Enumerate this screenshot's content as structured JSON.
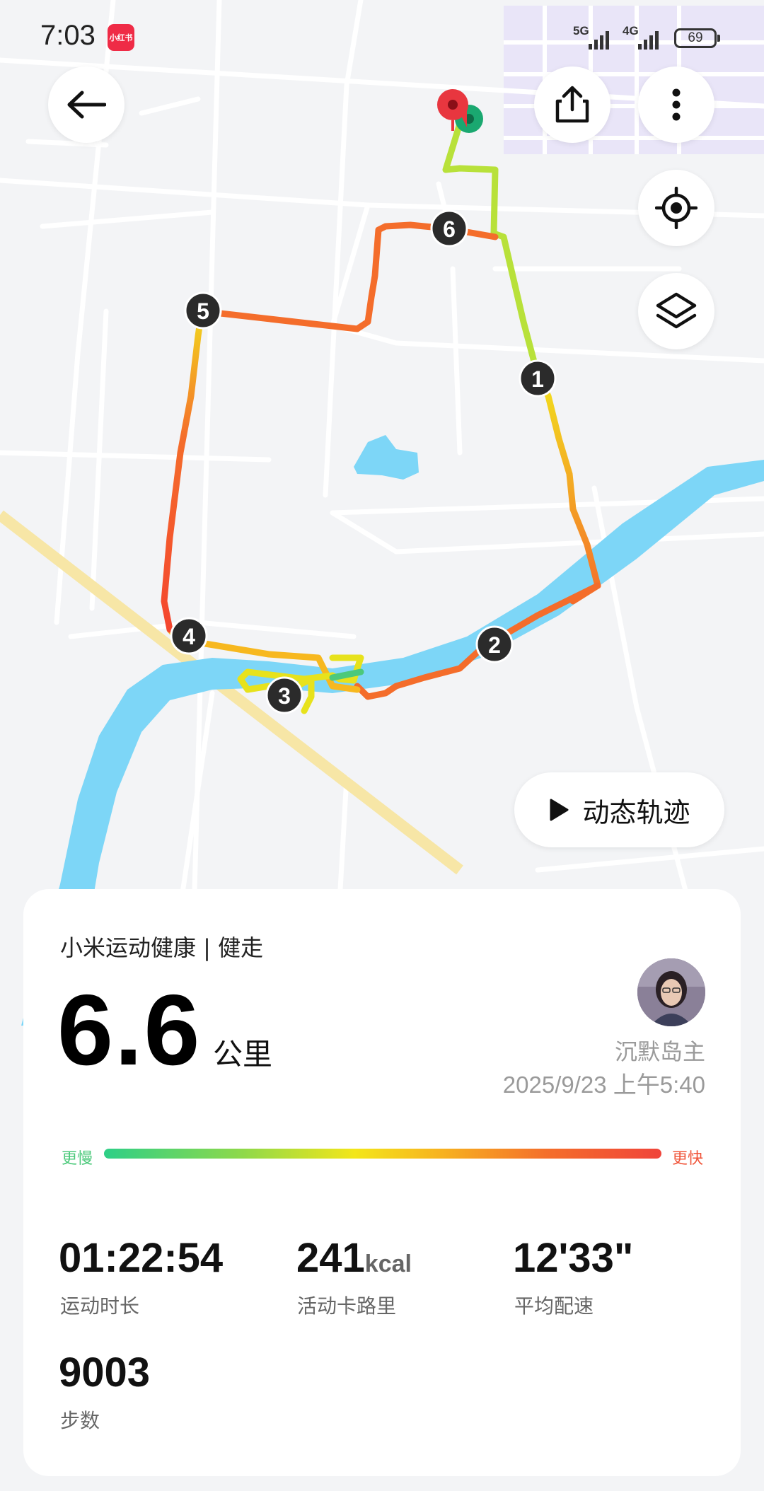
{
  "status_bar": {
    "time": "7:03",
    "notification_app": "小红书",
    "network_1": "5G",
    "network_2": "4G",
    "battery": "69"
  },
  "map": {
    "markers": [
      "1",
      "2",
      "3",
      "4",
      "5",
      "6"
    ],
    "replay_label": "动态轨迹"
  },
  "summary": {
    "app_title": "小米运动健康 | 健走",
    "distance_value": "6.6",
    "distance_unit": "公里",
    "username": "沉默岛主",
    "datetime": "2025/9/23 上午5:40",
    "pace_slow_label": "更慢",
    "pace_fast_label": "更快"
  },
  "stats": {
    "duration": {
      "value": "01:22:54",
      "label": "运动时长"
    },
    "calories": {
      "value": "241",
      "unit": "kcal",
      "label": "活动卡路里"
    },
    "pace": {
      "value": "12'33\"",
      "label": "平均配速"
    },
    "steps": {
      "value": "9003",
      "label": "步数"
    }
  },
  "colors": {
    "river": "#7dd6f7",
    "route_slow": "#2ecf87",
    "route_fast": "#f0443a",
    "marker": "#2b2b2b",
    "start_pin": "#e8363f",
    "end_dot": "#1aa870"
  }
}
